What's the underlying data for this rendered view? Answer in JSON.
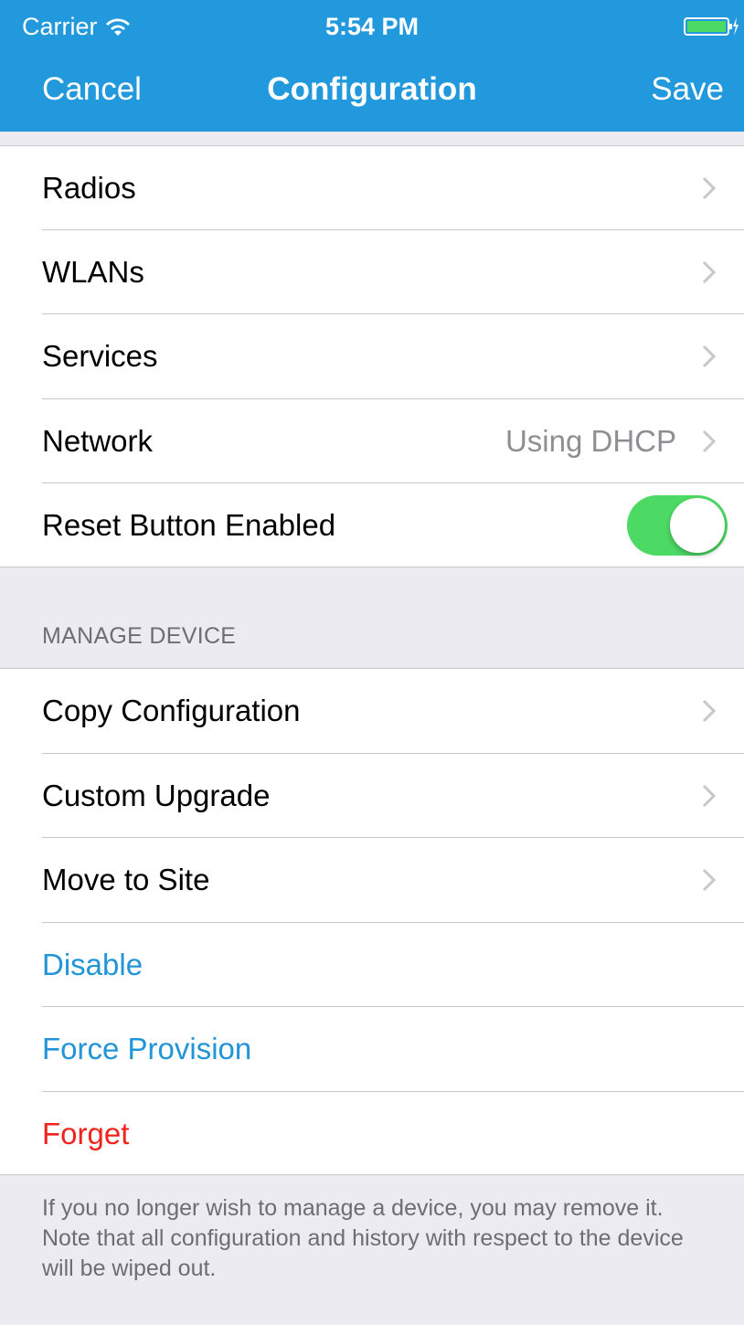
{
  "status_bar": {
    "carrier": "Carrier",
    "time": "5:54 PM",
    "wifi_icon": "wifi-icon",
    "battery_icon": "battery-charging-icon"
  },
  "nav": {
    "cancel_label": "Cancel",
    "title": "Configuration",
    "save_label": "Save"
  },
  "config_rows": [
    {
      "label": "Radios"
    },
    {
      "label": "WLANs"
    },
    {
      "label": "Services"
    },
    {
      "label": "Network",
      "value": "Using DHCP"
    },
    {
      "label": "Reset Button Enabled",
      "toggle_on": true
    }
  ],
  "manage_section": {
    "header": "MANAGE DEVICE",
    "rows": [
      {
        "label": "Copy Configuration"
      },
      {
        "label": "Custom Upgrade"
      },
      {
        "label": "Move to Site"
      },
      {
        "label": "Disable"
      },
      {
        "label": "Force Provision"
      },
      {
        "label": "Forget"
      }
    ],
    "footer": "If you no longer wish to manage a device, you may remove it. Note that all configuration and history with respect to the device will be wiped out."
  },
  "colors": {
    "nav_background": "#2299dd",
    "toggle_on": "#4cd964",
    "action_blue": "#2294d8",
    "destructive_red": "#f0241c",
    "group_background": "#ebebf1"
  }
}
